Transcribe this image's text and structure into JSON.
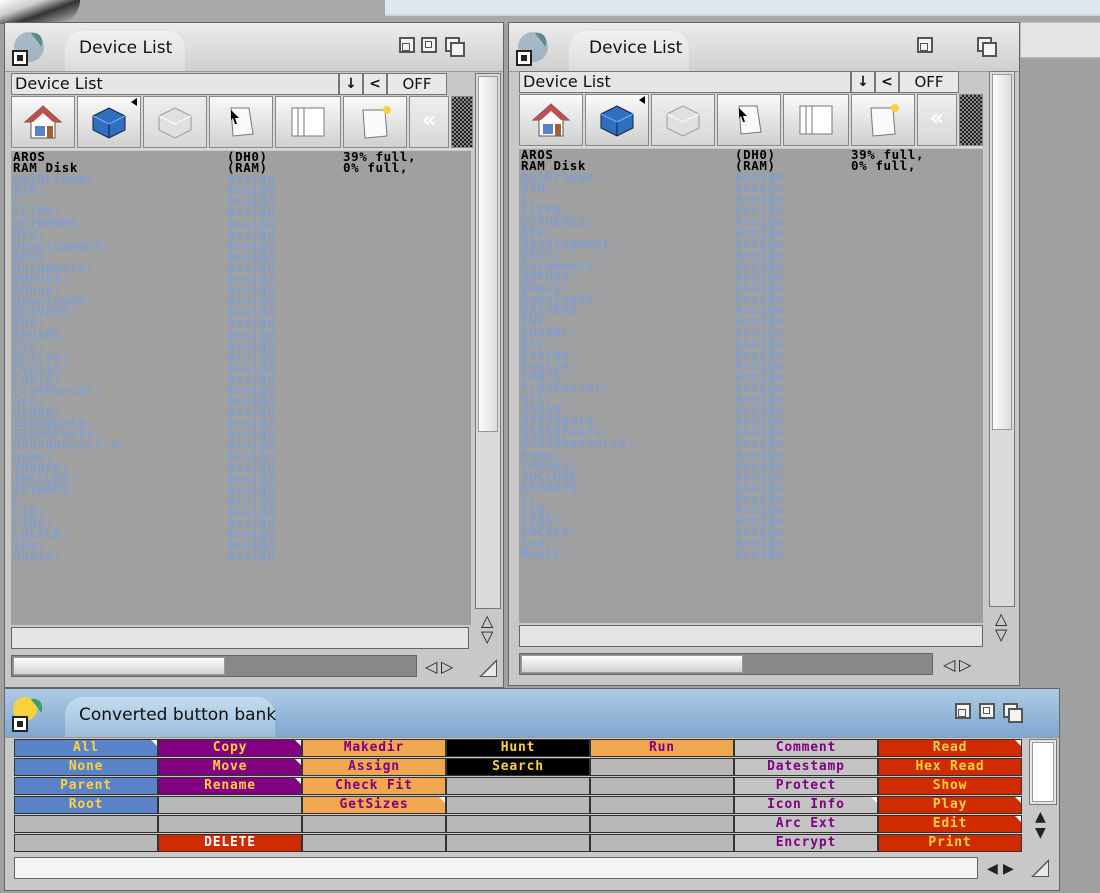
{
  "window1": {
    "title": "Device List"
  },
  "window2": {
    "title": "Device List"
  },
  "lister": {
    "path": "Device List",
    "down_arrow": "↓",
    "back_arrow": "<",
    "off_label": "OFF",
    "rewind_glyph": "«"
  },
  "devices": [
    {
      "name": "AROS",
      "id": "(DH0)",
      "info": "39% full,"
    },
    {
      "name": "RAM Disk",
      "id": "(RAM)",
      "info": "0% full,"
    }
  ],
  "assign_type": "Assign",
  "assigns_left": [
    "AmiBridge:",
    "BIN:",
    "C:",
    "CLIPS:",
    "D5THEMES:",
    "DEV:",
    "Development:",
    "DEVS:",
    "Documents:",
    "DOPUS5:",
    "DOpus:",
    "Downloads:",
    "DRIVERS:",
    "ENV:",
    "ENVARC:",
    "Etc:",
    "Extras:",
    "Feelin:",
    "FONTS:",
    "FreePascal:",
    "GCC:",
    "G5850:",
    "G5850Data:",
    "G5850Fonts:",
    "G5850Resource:",
    "home:",
    "IMAGES:",
    "INCLUDE:",
    "KEYMAPS:",
    "L:",
    "LIB:",
    "LIBS:",
    "LOCALE:",
    "lua:",
    "Music:"
  ],
  "assigns_right": [
    "AmiBridge:",
    "BIN:",
    "C:",
    "CLIPS:",
    "D5THEMES:",
    "DEV:",
    "Development:",
    "DEVS:",
    "Documents:",
    "DOPUS5:",
    "DOpus:",
    "Downloads:",
    "DRIVERS:",
    "ENV:",
    "ENVARC:",
    "Etc:",
    "Extras:",
    "Feelin:",
    "FONTS:",
    "FreePascal:",
    "GCC:",
    "G5850:",
    "G5850Data:",
    "G5850Fonts:",
    "G5850Resource:",
    "home:",
    "IMAGES:",
    "INCLUDE:",
    "KEYMAPS:",
    "L:",
    "LIB:",
    "LIBS:",
    "LOCALE:",
    "lua:",
    "Music:"
  ],
  "scroll_glyphs": {
    "up": "△",
    "down": "▽",
    "left": "◁",
    "right": "▷"
  },
  "button_bank": {
    "title": "Converted button bank",
    "columns": [
      [
        "All",
        "None",
        "Parent",
        "Root",
        "",
        ""
      ],
      [
        "Copy",
        "Move",
        "Rename",
        "",
        "",
        "DELETE"
      ],
      [
        "Makedir",
        "Assign",
        "Check Fit",
        "GetSizes",
        "",
        ""
      ],
      [
        "Hunt",
        "Search",
        "",
        "",
        "",
        ""
      ],
      [
        "Run",
        "",
        "",
        "",
        "",
        ""
      ],
      [
        "Comment",
        "Datestamp",
        "Protect",
        "Icon Info",
        "Arc Ext",
        "Encrypt"
      ],
      [
        "Read",
        "Hex Read",
        "Show",
        "Play",
        "Edit",
        "Print"
      ]
    ],
    "colors": {
      "blue": "#5a82c8",
      "purple": "#800080",
      "orange": "#f0a850",
      "black": "#000000",
      "gray": "#b8b8b8",
      "red": "#d02a00",
      "lightgray": "#c4c4c4"
    }
  }
}
